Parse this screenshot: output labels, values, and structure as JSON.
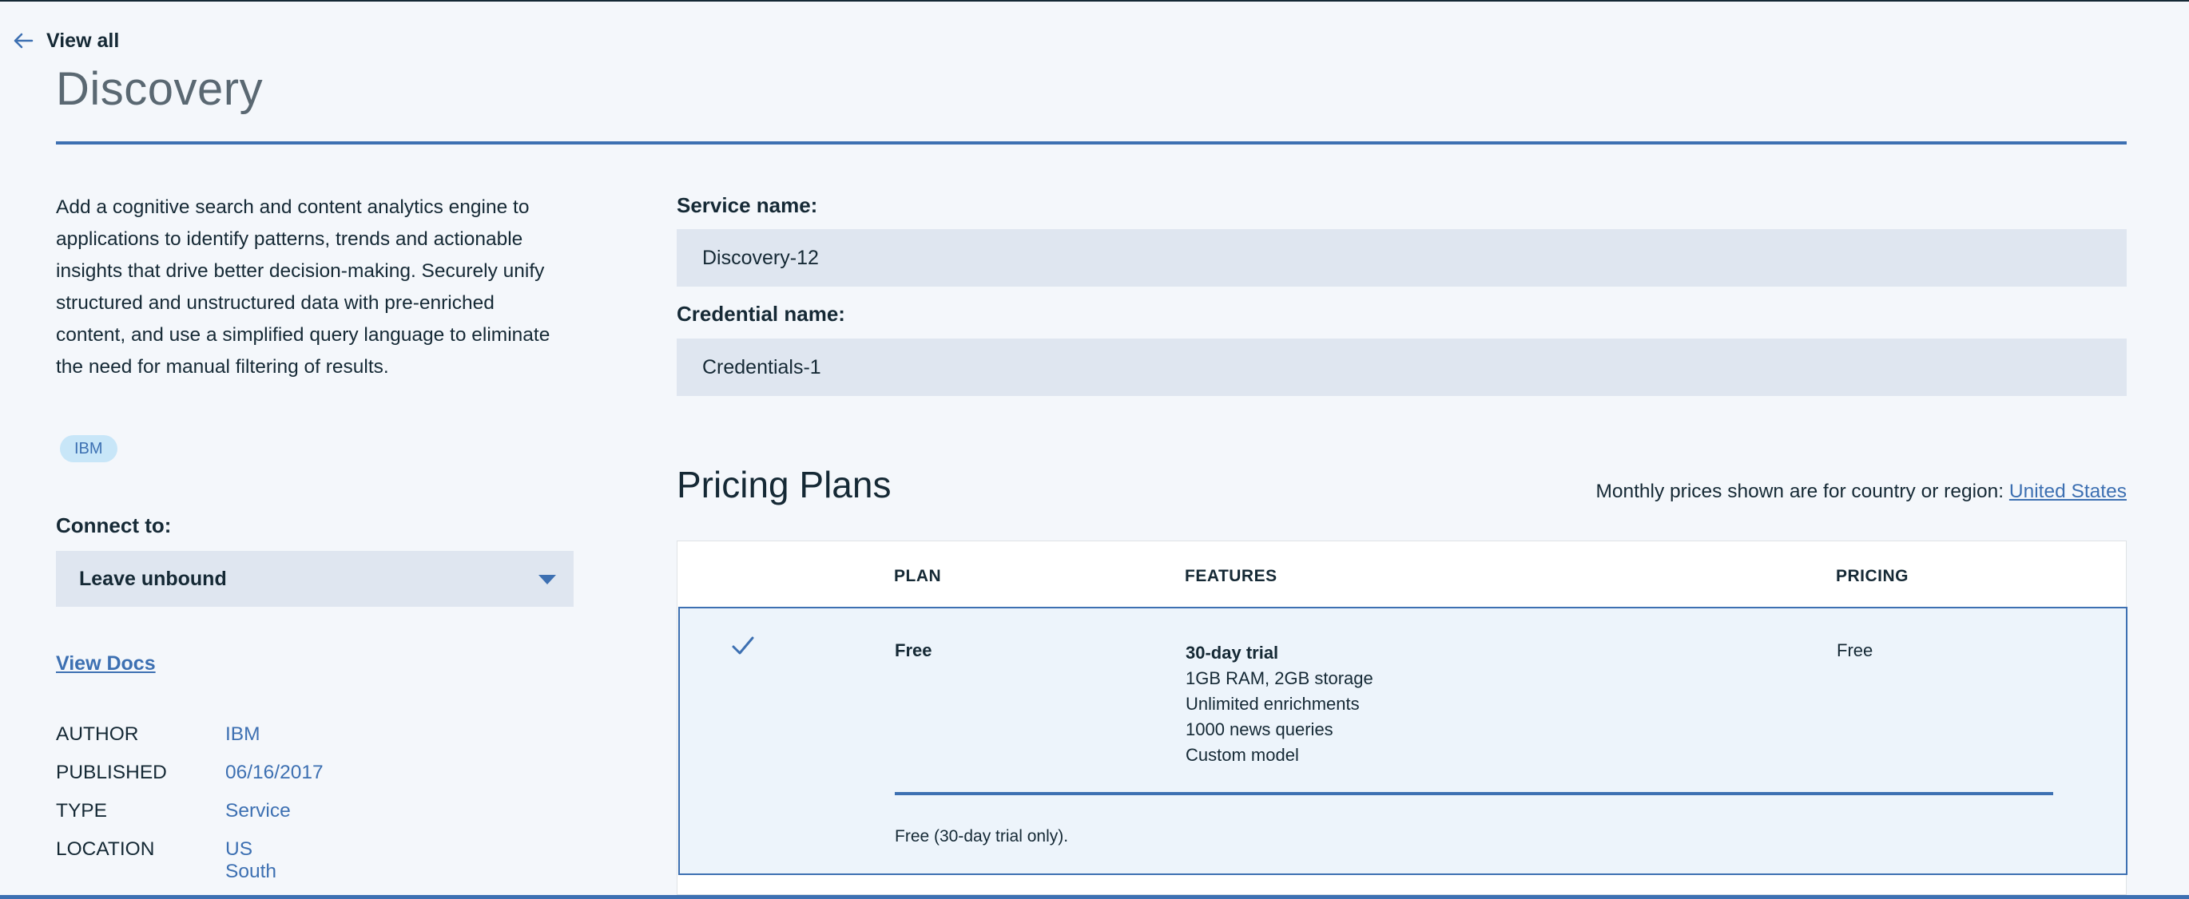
{
  "nav": {
    "back_label": "View all"
  },
  "page": {
    "title": "Discovery"
  },
  "description": "Add a cognitive search and content analytics engine to applications to identify patterns, trends and actionable insights that drive better decision-making. Securely unify structured and unstructured data with pre-enriched content, and use a simplified query language to eliminate the need for manual filtering of results.",
  "tag": "IBM",
  "connect": {
    "label": "Connect to:",
    "selected": "Leave unbound"
  },
  "docs_link": "View Docs",
  "meta": [
    {
      "key": "AUTHOR",
      "value": "IBM"
    },
    {
      "key": "PUBLISHED",
      "value": "06/16/2017"
    },
    {
      "key": "TYPE",
      "value": "Service"
    },
    {
      "key": "LOCATION",
      "value": "US South"
    }
  ],
  "form": {
    "service_label": "Service name:",
    "service_value": "Discovery-12",
    "credential_label": "Credential name:",
    "credential_value": "Credentials-1"
  },
  "pricing": {
    "heading": "Pricing Plans",
    "region_text": "Monthly prices shown are for country or region:",
    "region_link": "United States",
    "columns": {
      "plan": "PLAN",
      "features": "FEATURES",
      "pricing": "PRICING"
    },
    "plans": [
      {
        "name": "Free",
        "feature_title": "30-day trial",
        "features": [
          "1GB RAM, 2GB storage",
          "Unlimited enrichments",
          "1000 news queries",
          "Custom model"
        ],
        "price": "Free",
        "note": "Free (30-day trial only).",
        "selected": true
      }
    ]
  },
  "colors": {
    "accent": "#3d70b2",
    "text": "#152935",
    "field_bg": "#dfe6f0",
    "selected_row_bg": "#edf4fb",
    "page_bg": "#f4f7fb"
  },
  "icons": {
    "back": "arrow-left-icon",
    "dropdown": "caret-down-icon",
    "selected": "checkmark-icon"
  }
}
